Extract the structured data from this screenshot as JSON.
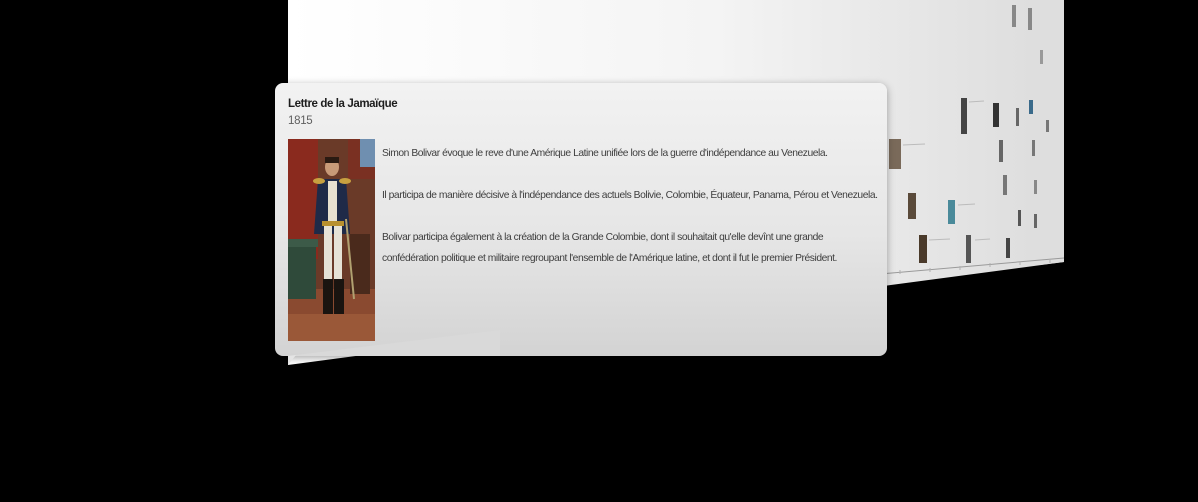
{
  "event": {
    "title": "Lettre de la Jamaïque",
    "year": "1815",
    "paragraphs": [
      "Simon Bolivar évoque le reve d'une Amérique Latine unifiée lors de la guerre d'indépendance au Venezuela.",
      "Il participa de manière décisive à l'indépendance des actuels Bolivie, Colombie, Équateur, Panama, Pérou et Venezuela.",
      "Bolivar participa également à la création de la Grande Colombie, dont il souhaitait qu'elle devînt une grande confédération politique et militaire regroupant l'ensemble de l'Amérique latine, et dont il fut le premier Président."
    ]
  }
}
